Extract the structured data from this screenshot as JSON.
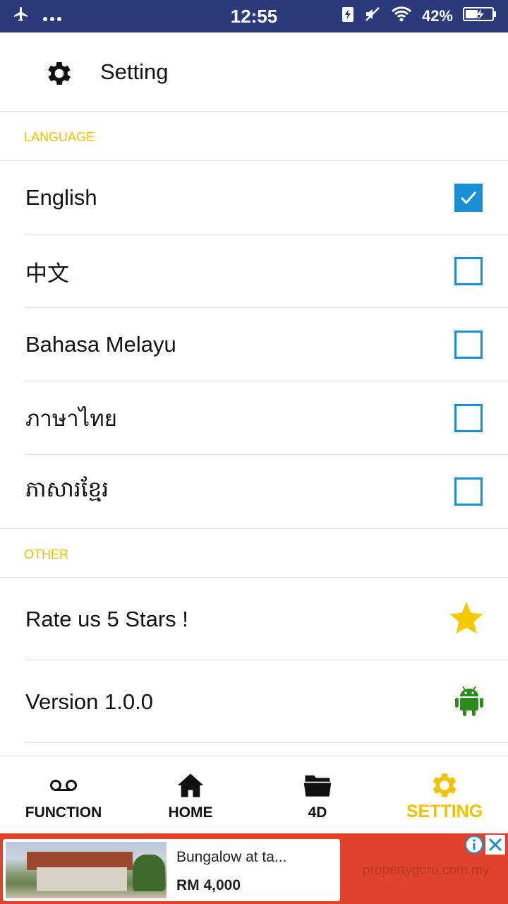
{
  "status_bar": {
    "time": "12:55",
    "battery_percent": "42%",
    "icons": [
      "airplane-icon",
      "more-dots-icon",
      "battery-saver-icon",
      "mute-icon",
      "wifi-icon",
      "battery-icon"
    ]
  },
  "header": {
    "title": "Setting",
    "icon": "gear-icon"
  },
  "language_section": {
    "heading": "LANGUAGE",
    "items": [
      {
        "label": "English",
        "checked": true
      },
      {
        "label": "中文",
        "checked": false
      },
      {
        "label": "Bahasa Melayu",
        "checked": false
      },
      {
        "label": "ภาษาไทย",
        "checked": false
      },
      {
        "label": "ភាសារខ្មែរ",
        "checked": false
      }
    ]
  },
  "other_section": {
    "heading": "OTHER",
    "items": [
      {
        "label": "Rate us 5 Stars !",
        "icon": "star-icon"
      },
      {
        "label": "Version 1.0.0",
        "icon": "android-icon"
      }
    ]
  },
  "bottom_nav": {
    "items": [
      {
        "label": "FUNCTION",
        "icon": "voicemail-icon",
        "active": false
      },
      {
        "label": "HOME",
        "icon": "home-icon",
        "active": false
      },
      {
        "label": "4D",
        "icon": "folder-icon",
        "active": false
      },
      {
        "label": "SETTING",
        "icon": "gear-icon",
        "active": true
      }
    ]
  },
  "ad": {
    "title": "Bungalow at ta...",
    "price": "RM 4,000",
    "domain": "propertyguru.com.my"
  },
  "colors": {
    "status_bar": "#2b3a7a",
    "accent_yellow": "#f2c200",
    "checkbox_blue": "#1b8fd6",
    "android_green": "#2e8b1e",
    "ad_red": "#e0422c"
  }
}
